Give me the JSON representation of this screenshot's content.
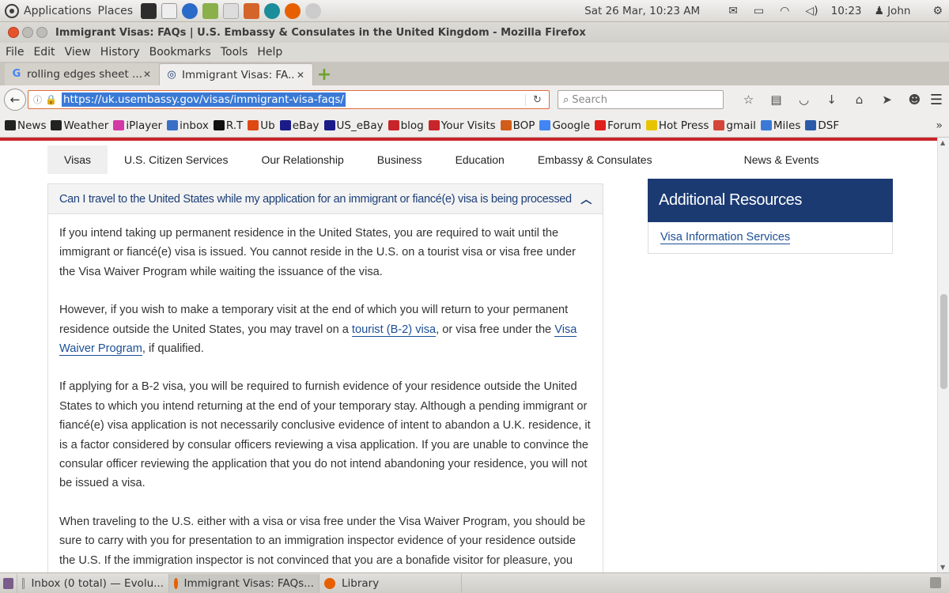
{
  "top_panel": {
    "applications": "Applications",
    "places": "Places",
    "datetime": "Sat 26 Mar, 10:23 AM",
    "time": "10:23",
    "user": "John"
  },
  "window": {
    "title": "Immigrant Visas: FAQs | U.S. Embassy & Consulates in the United Kingdom - Mozilla Firefox"
  },
  "menu": [
    "File",
    "Edit",
    "View",
    "History",
    "Bookmarks",
    "Tools",
    "Help"
  ],
  "tabs": [
    {
      "label": "rolling edges sheet ...",
      "active": false
    },
    {
      "label": "Immigrant Visas: FA...",
      "active": true
    }
  ],
  "nav": {
    "url": "https://uk.usembassy.gov/visas/immigrant-visa-faqs/",
    "search_placeholder": "Search"
  },
  "bookmarks": [
    {
      "label": "News",
      "icon": "bbc-icon",
      "color": "#222"
    },
    {
      "label": "Weather",
      "icon": "bbc-icon",
      "color": "#222"
    },
    {
      "label": "iPlayer",
      "icon": "iplayer-icon",
      "color": "#d33aa6"
    },
    {
      "label": "inbox",
      "icon": "ox-icon",
      "color": "#3a6fc8"
    },
    {
      "label": "R.T",
      "icon": "rt-icon",
      "color": "#111"
    },
    {
      "label": "Ub",
      "icon": "ubuntu-icon",
      "color": "#dd4814"
    },
    {
      "label": "eBay",
      "icon": "ebay-icon",
      "color": "#1b1b8a"
    },
    {
      "label": "US_eBay",
      "icon": "ebay-icon",
      "color": "#1b1b8a"
    },
    {
      "label": "blog",
      "icon": "blog-icon",
      "color": "#c8252b"
    },
    {
      "label": "Your Visits",
      "icon": "s-icon",
      "color": "#c8252b"
    },
    {
      "label": "BOP",
      "icon": "bop-icon",
      "color": "#d25c1a"
    },
    {
      "label": "Google",
      "icon": "google-icon",
      "color": "#4285f4"
    },
    {
      "label": "Forum",
      "icon": "pca-icon",
      "color": "#e0201a"
    },
    {
      "label": "Hot Press",
      "icon": "hotpress-icon",
      "color": "#e8c400"
    },
    {
      "label": "gmail",
      "icon": "gmail-icon",
      "color": "#d44638"
    },
    {
      "label": "Miles",
      "icon": "miles-icon",
      "color": "#3a7ad6"
    },
    {
      "label": "DSF",
      "icon": "dsf-icon",
      "color": "#2b5aa8"
    }
  ],
  "site_nav": [
    "Visas",
    "U.S. Citizen Services",
    "Our Relationship",
    "Business",
    "Education",
    "Embassy & Consulates",
    "News & Events"
  ],
  "faq": {
    "title": "Can I travel to the United States while my application for an immigrant or fiancé(e) visa is being processed",
    "p1": "If you intend taking up permanent residence in the United States, you are required to wait until the immigrant or fiancé(e) visa is issued. You cannot reside in the U.S. on a tourist visa or visa free under the Visa Waiver Program while waiting the issuance of the visa.",
    "p2_before": "However, if you wish to make a temporary visit at the end of which you will return to your permanent residence outside the United States, you may travel on a ",
    "p2_link1": "tourist (B-2) visa",
    "p2_mid": ", or visa free under the ",
    "p2_link2": "Visa Waiver Program",
    "p2_after": ", if qualified.",
    "p3": "If applying for a B-2 visa, you will be required to furnish evidence of your residence outside the United States to which you intend returning at the end of your temporary stay. Although a pending immigrant or fiancé(e) visa application is not necessarily conclusive evidence of intent to abandon a U.K. residence, it is a factor considered by consular officers reviewing a visa application. If you are unable to convince the consular officer reviewing the application that you do not intend abandoning your residence, you will not be issued a visa.",
    "p4": "When traveling to the U.S. either with a visa or visa free under the Visa Waiver Program, you should be sure to carry with you for presentation to an immigration inspector evidence of your residence outside the U.S. If the immigration inspector is not convinced that you are a bonafide visitor for pleasure, you"
  },
  "sidebar": {
    "title": "Additional Resources",
    "link": "Visa Information Services"
  },
  "taskbar": [
    {
      "label": "Inbox (0 total) — Evolu...",
      "active": false
    },
    {
      "label": "Immigrant Visas: FAQs...",
      "active": true
    },
    {
      "label": "Library",
      "active": false
    }
  ],
  "colors": {
    "embassy_red": "#c8252b",
    "embassy_navy": "#1b3a72",
    "link_blue": "#1c4f96"
  }
}
